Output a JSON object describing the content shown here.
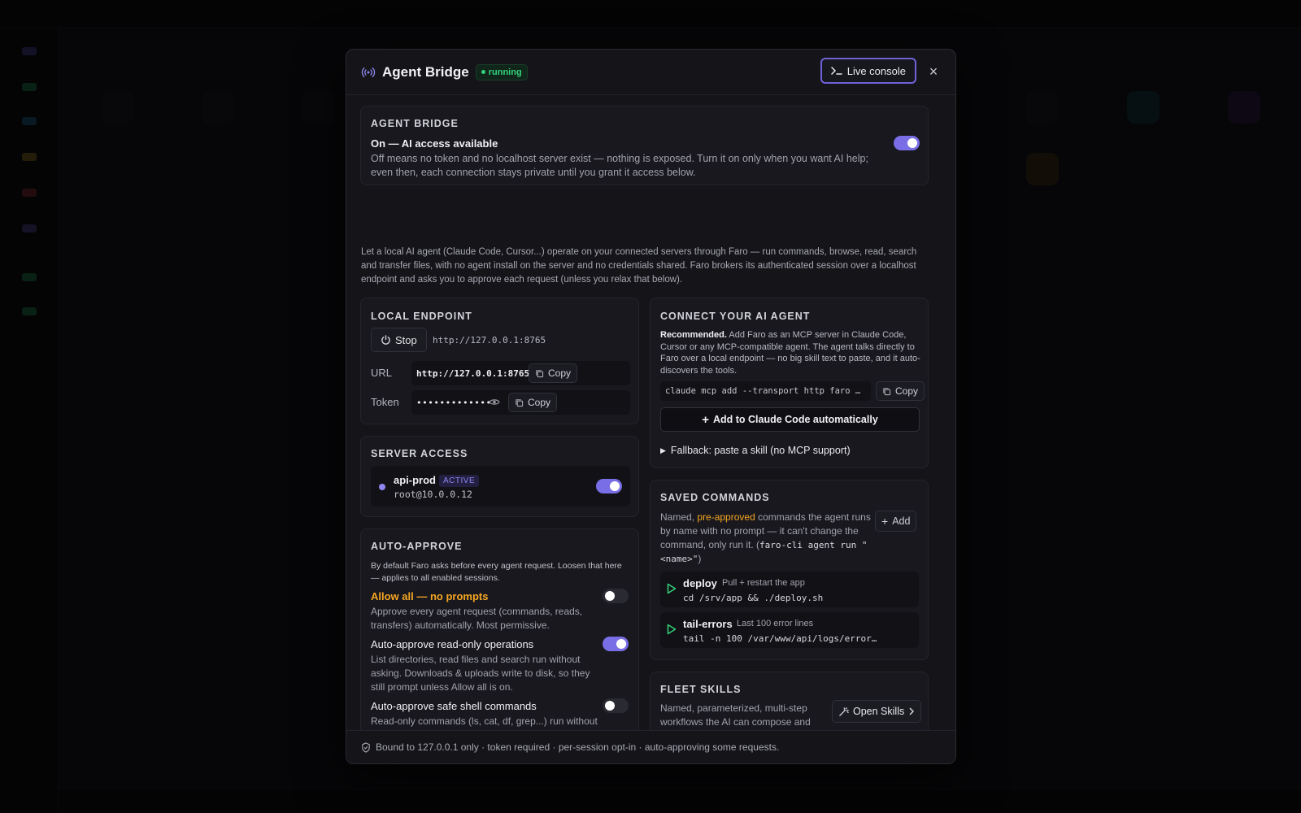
{
  "modal": {
    "title": "Agent Bridge",
    "status": "running",
    "live_console_label": "Live console",
    "close_glyph": "×"
  },
  "agent_bridge": {
    "section_title": "AGENT BRIDGE",
    "state_title": "On — AI access available",
    "state_desc": "Off means no token and no localhost server exist — nothing is exposed. Turn it on only when you want AI help; even then, each connection stays private until you grant it access below.",
    "enabled": true
  },
  "intro": "Let a local AI agent (Claude Code, Cursor...) operate on your connected servers through Faro — run commands, browse, read, search and transfer files, with no agent install on the server and no credentials shared. Faro brokers its authenticated session over a localhost endpoint and asks you to approve each request (unless you relax that below).",
  "local_endpoint": {
    "section_title": "LOCAL ENDPOINT",
    "stop_label": "Stop",
    "endpoint_url": "http://127.0.0.1:8765",
    "url_label": "URL",
    "url_value": "http://127.0.0.1:8765",
    "token_label": "Token",
    "token_value": "•••••••••••••",
    "copy_label": "Copy"
  },
  "server_access": {
    "section_title": "SERVER ACCESS",
    "servers": [
      {
        "name": "api-prod",
        "badge": "ACTIVE",
        "host": "root@10.0.0.12",
        "enabled": true
      }
    ]
  },
  "auto_approve": {
    "section_title": "AUTO-APPROVE",
    "desc": "By default Faro asks before every agent request. Loosen that here — applies to all enabled sessions.",
    "options": [
      {
        "title": "Allow all — no prompts",
        "desc": "Approve every agent request (commands, reads, transfers) automatically. Most permissive.",
        "enabled": false
      },
      {
        "title": "Auto-approve read-only operations",
        "desc": "List directories, read files and search run without asking. Downloads & uploads write to disk, so they still prompt unless Allow all is on.",
        "enabled": true
      },
      {
        "title": "Auto-approve safe shell commands",
        "desc": "Read-only commands (ls, cat, df, grep...) run without asking; anything that could change the server still prompts. Best-effort heuristic.",
        "enabled": false
      }
    ]
  },
  "connect_agent": {
    "section_title": "CONNECT YOUR AI AGENT",
    "recommended": "Recommended.",
    "desc": " Add Faro as an MCP server in Claude Code, Cursor or any MCP-compatible agent. The agent talks directly to Faro over a local endpoint — no big skill text to paste, and it auto-discovers the tools.",
    "command": "claude mcp add --transport http faro …",
    "copy_label": "Copy",
    "add_auto_label": "Add to Claude Code automatically",
    "fallback_label": "Fallback: paste a skill (no MCP support)"
  },
  "saved_commands": {
    "section_title": "SAVED COMMANDS",
    "desc_prefix": "Named, ",
    "desc_highlight": "pre-approved",
    "desc_mid": " commands the agent runs by name with no prompt — it can't change the command, only run it. (",
    "desc_code": "faro-cli agent run \"<name>\"",
    "desc_suffix": ")",
    "add_label": "Add",
    "commands": [
      {
        "name": "deploy",
        "desc": "Pull + restart the app",
        "cmd": "cd /srv/app && ./deploy.sh"
      },
      {
        "name": "tail-errors",
        "desc": "Last 100 error lines",
        "cmd": "tail -n 100 /var/www/api/logs/error…"
      }
    ]
  },
  "fleet_skills": {
    "section_title": "FLEET SKILLS",
    "desc": "Named, parameterized, multi-step workflows the AI can compose and run across many servers. Approve AI proposals, author your own, dry-run, then run — with a per-target result",
    "open_label": "Open Skills"
  },
  "footer": "Bound to 127.0.0.1 only · token required · per-session opt-in · auto-approving some requests.",
  "colors": {
    "accent": "#7a6ee6",
    "running_green": "#34d27a",
    "warning_orange": "#f5a623",
    "active_badge": "#8f86f2"
  }
}
